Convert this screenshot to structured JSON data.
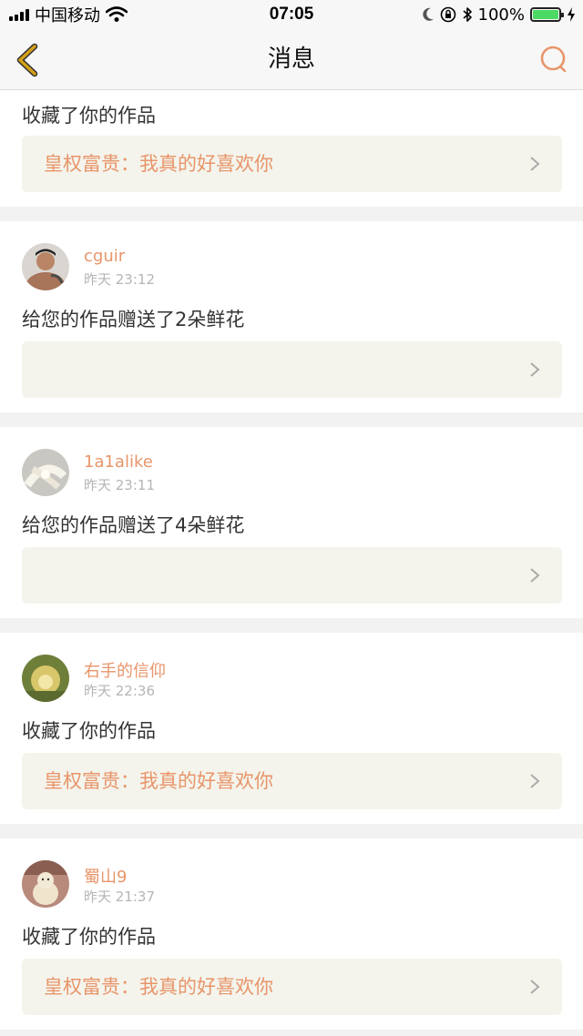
{
  "status_bar": {
    "carrier": "中国移动",
    "time": "07:05",
    "battery": "100%"
  },
  "header": {
    "title": "消息"
  },
  "colors": {
    "accent": "#e8956a",
    "back_icon": "#d4a017"
  },
  "messages": [
    {
      "action": "收藏了你的作品",
      "work_title": "皇权富贵：我真的好喜欢你"
    },
    {
      "username": "cguir",
      "time": "昨天 23:12",
      "action": "给您的作品赠送了2朵鲜花",
      "work_title": ""
    },
    {
      "username": "1a1alike",
      "time": "昨天 23:11",
      "action": "给您的作品赠送了4朵鲜花",
      "work_title": ""
    },
    {
      "username": "右手的信仰",
      "time": "昨天 22:36",
      "action": "收藏了你的作品",
      "work_title": "皇权富贵：我真的好喜欢你"
    },
    {
      "username": "蜀山9",
      "time": "昨天 21:37",
      "action": "收藏了你的作品",
      "work_title": "皇权富贵：我真的好喜欢你"
    }
  ]
}
